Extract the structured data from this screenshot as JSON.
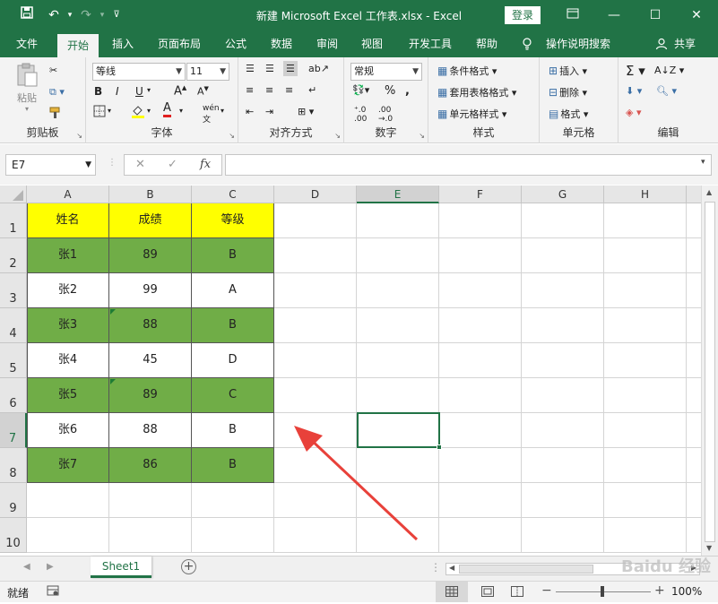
{
  "titlebar": {
    "title": "新建 Microsoft Excel 工作表.xlsx  -  Excel",
    "login": "登录",
    "qat_icons": [
      "save-icon",
      "undo-icon",
      "redo-icon",
      "customize-icon"
    ],
    "window_buttons": [
      "ribbon-display-icon",
      "minimize-icon",
      "maximize-icon",
      "close-icon"
    ]
  },
  "menu": {
    "tabs": [
      "文件",
      "开始",
      "插入",
      "页面布局",
      "公式",
      "数据",
      "审阅",
      "视图",
      "开发工具",
      "帮助"
    ],
    "active": "开始",
    "tell_me": "操作说明搜索",
    "share": "共享"
  },
  "ribbon": {
    "clipboard": {
      "label": "剪贴板",
      "paste": "粘贴"
    },
    "font": {
      "label": "字体",
      "font_name": "等线",
      "font_size": "11",
      "bold": "B",
      "italic": "I",
      "underline": "U"
    },
    "alignment": {
      "label": "对齐方式"
    },
    "number": {
      "label": "数字",
      "format": "常规"
    },
    "styles": {
      "label": "样式",
      "conditional": "条件格式",
      "table": "套用表格格式",
      "cell": "单元格样式"
    },
    "cells": {
      "label": "单元格",
      "insert": "插入",
      "delete": "删除",
      "format": "格式"
    },
    "editing": {
      "label": "编辑"
    }
  },
  "formula_bar": {
    "name_box": "E7",
    "fx": "fx",
    "content": ""
  },
  "columns": [
    "A",
    "B",
    "C",
    "D",
    "E",
    "F",
    "G",
    "H"
  ],
  "selected_column": "E",
  "rows": [
    "1",
    "2",
    "3",
    "4",
    "5",
    "6",
    "7",
    "8",
    "9",
    "10"
  ],
  "selected_row": "7",
  "table": {
    "header": [
      "姓名",
      "成绩",
      "等级"
    ],
    "rows": [
      [
        "张1",
        "89",
        "B"
      ],
      [
        "张2",
        "99",
        "A"
      ],
      [
        "张3",
        "88",
        "B"
      ],
      [
        "张4",
        "45",
        "D"
      ],
      [
        "张5",
        "89",
        "C"
      ],
      [
        "张6",
        "88",
        "B"
      ],
      [
        "张7",
        "86",
        "B"
      ]
    ]
  },
  "colors": {
    "excel_green": "#217346",
    "header_fill": "#ffff00",
    "band_fill": "#70ad47",
    "white": "#ffffff",
    "arrow": "#e8413a"
  },
  "sheet": {
    "name": "Sheet1",
    "add": "+"
  },
  "status": {
    "ready": "就绪",
    "zoom": "100%"
  },
  "watermark": "Baidu 经验"
}
